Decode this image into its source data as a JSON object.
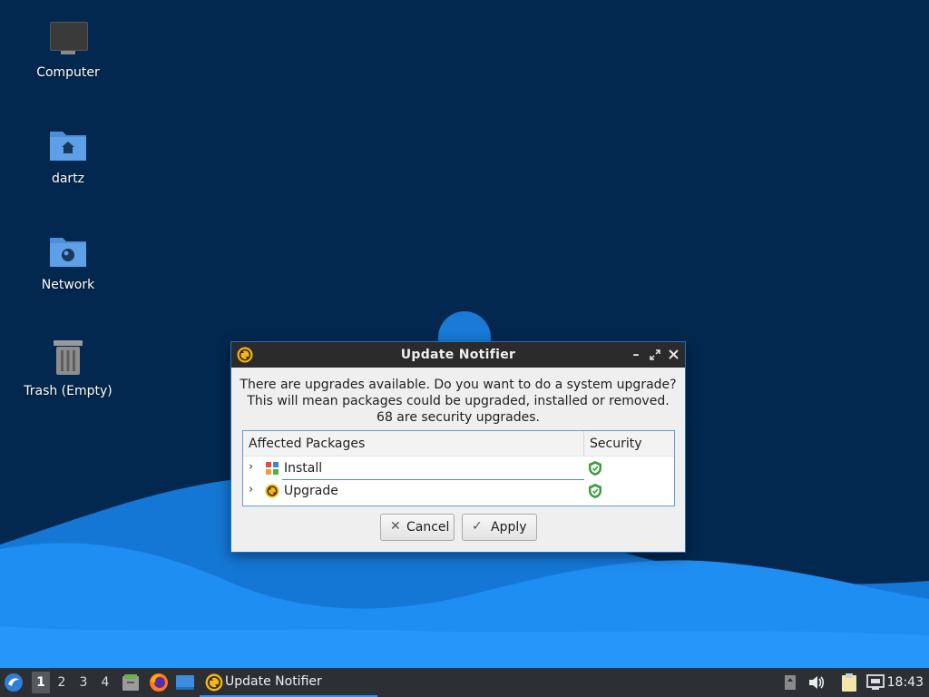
{
  "desktop": {
    "icons": [
      {
        "label": "Computer",
        "icon": "computer-icon"
      },
      {
        "label": "dartz",
        "icon": "home-folder-icon"
      },
      {
        "label": "Network",
        "icon": "network-folder-icon"
      },
      {
        "label": "Trash (Empty)",
        "icon": "trash-icon"
      }
    ]
  },
  "dialog": {
    "title": "Update Notifier",
    "message": {
      "line1": "There are upgrades available. Do you want to do a system upgrade?",
      "line2": "This will mean packages could be upgraded, installed or removed.",
      "line3": "68 are security upgrades."
    },
    "table": {
      "col_packages": "Affected Packages",
      "col_security": "Security",
      "rows": [
        {
          "label": "Install",
          "icon": "install-packages-icon",
          "security_icon": "shield-check-icon"
        },
        {
          "label": "Upgrade",
          "icon": "upgrade-icon",
          "security_icon": "shield-check-icon"
        }
      ]
    },
    "buttons": {
      "cancel": "Cancel",
      "apply": "Apply"
    },
    "window_controls": [
      "minimize",
      "maximize",
      "close"
    ]
  },
  "taskbar": {
    "workspaces": [
      "1",
      "2",
      "3",
      "4"
    ],
    "active_workspace": "1",
    "task_label": "Update Notifier",
    "clock": "18:43"
  },
  "colors": {
    "desktop_bg": "#03284f",
    "wave_blue": "#1e8ff5",
    "titlebar": "#2b2b2b",
    "accent": "#3a8ee6",
    "shield_green": "#3e9b3e",
    "taskbar": "#2c2f33"
  }
}
